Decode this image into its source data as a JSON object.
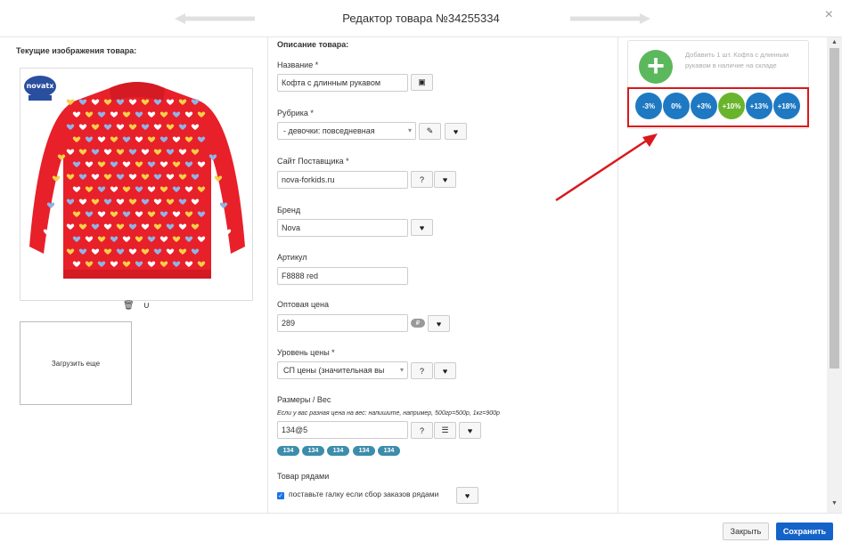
{
  "header": {
    "title": "Редактор товара №34255334"
  },
  "left": {
    "images_label": "Текущие изображения товара:",
    "brand_logo_text": "novatx",
    "upload_more": "Загрузить еще"
  },
  "description": {
    "section_label": "Описание товара:",
    "name": {
      "label": "Название *",
      "value": "Кофта с длинным рукавом"
    },
    "category": {
      "label": "Рубрика *",
      "value": "-  девочки: повседневная"
    },
    "supplier_site": {
      "label": "Сайт Поставщика *",
      "value": "nova-forkids.ru",
      "help": "?"
    },
    "brand": {
      "label": "Бренд",
      "value": "Nova"
    },
    "article": {
      "label": "Артикул",
      "value": "F8888 red"
    },
    "wholesale_price": {
      "label": "Оптовая цена",
      "value": "289"
    },
    "price_level": {
      "label": "Уровень цены *",
      "value": "СП цены (значительная вы",
      "help": "?"
    },
    "sizes": {
      "label": "Размеры / Вес",
      "hint": "Если у вас разная цена на вес: напишите, например, 500гр=500р, 1кг=900р",
      "value": "134@5",
      "help": "?",
      "tags": [
        "134",
        "134",
        "134",
        "134",
        "134"
      ]
    },
    "rows": {
      "label": "Товар рядами",
      "checkbox_label": "поставьте галку если сбор заказов рядами",
      "checked": true
    }
  },
  "right": {
    "add_text": "Добавить 1 шт. Кофта с длинным рукавом в наличие на складе",
    "percent_buttons": [
      "-3%",
      "0%",
      "+3%",
      "+10%",
      "+13%",
      "+18%"
    ],
    "active_percent": "+10%"
  },
  "footer": {
    "close_label": "Закрыть",
    "save_label": "Сохранить"
  },
  "colors": {
    "accent": "#1463c8",
    "percent_blue": "#1f79c2",
    "percent_active": "#6ab42d",
    "highlight_red": "#d9191d",
    "shirt_red": "#e8202a",
    "add_green": "#5cb85c"
  }
}
